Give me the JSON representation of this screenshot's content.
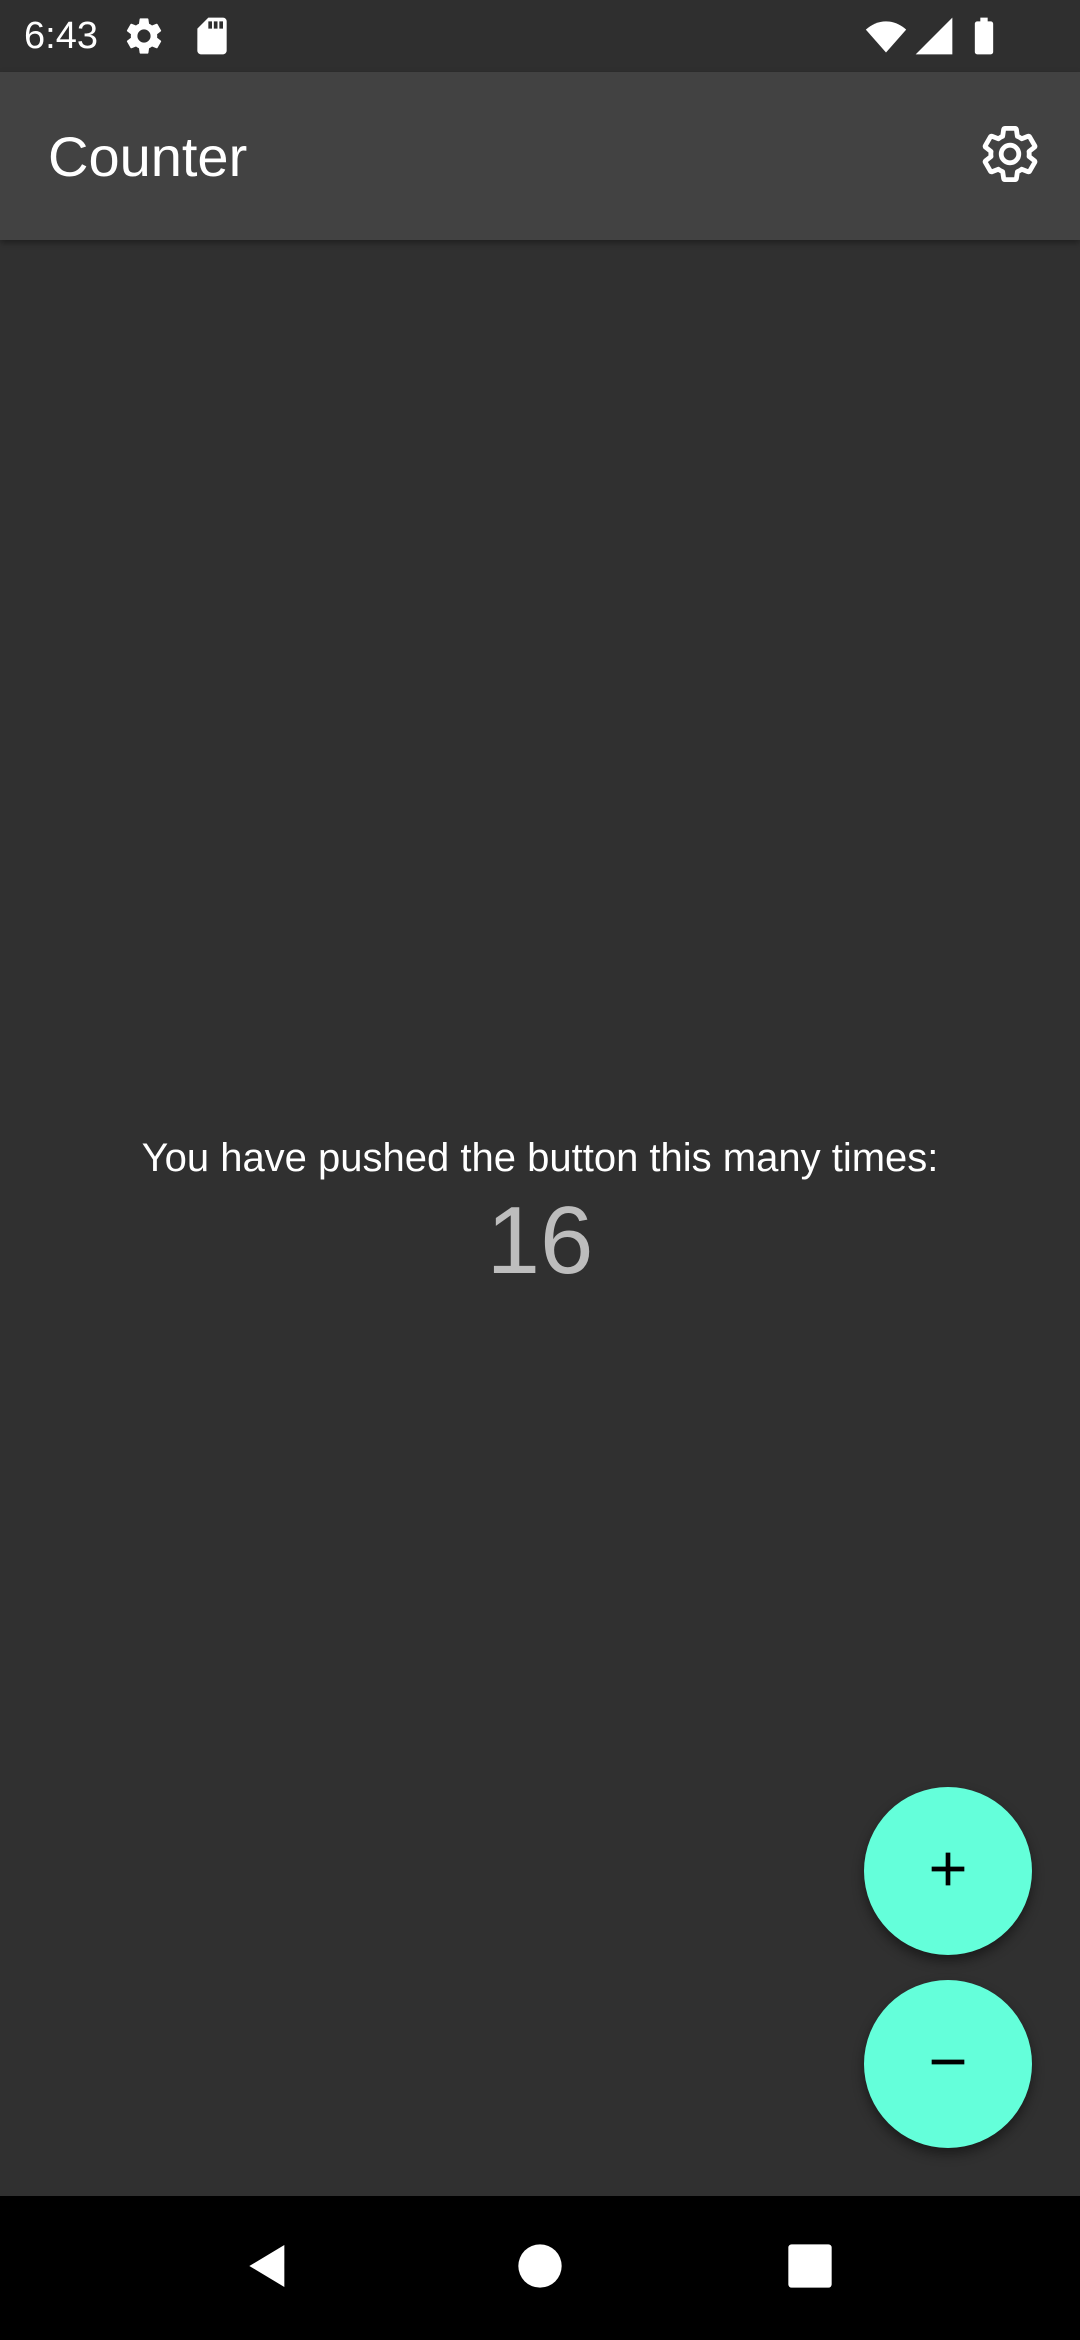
{
  "status_bar": {
    "time": "6:43",
    "icons": [
      "settings-gear-icon",
      "sd-card-icon",
      "wifi-icon",
      "cellular-signal-icon",
      "battery-icon"
    ]
  },
  "app_bar": {
    "title": "Counter",
    "settings_icon": "settings-gear-icon"
  },
  "main": {
    "message": "You have pushed the button this many times:",
    "counter": "16"
  },
  "fabs": {
    "increment_icon": "plus-icon",
    "decrement_icon": "minus-icon"
  },
  "nav_bar": {
    "buttons": [
      "back-triangle-icon",
      "home-circle-icon",
      "recents-square-icon"
    ]
  },
  "colors": {
    "background": "#303030",
    "app_bar": "#424242",
    "accent": "#64FFDA",
    "counter_text": "#BDBDBD",
    "nav_bar": "#000000"
  }
}
